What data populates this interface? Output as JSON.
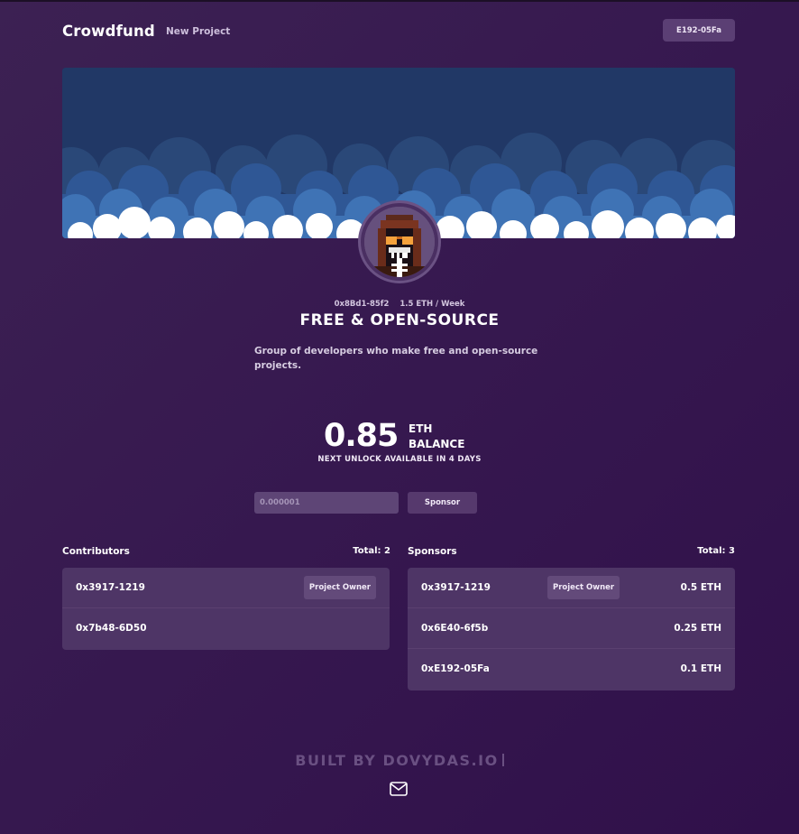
{
  "nav": {
    "brand": "Crowdfund",
    "new_project": "New Project",
    "wallet": "E192-05Fa"
  },
  "project": {
    "owner": "0x8Bd1-85f2",
    "rate": "1.5 ETH / Week",
    "title": "FREE & OPEN-SOURCE",
    "description": "Group of developers who make free and open-source projects."
  },
  "balance": {
    "value": "0.85",
    "unit": "ETH",
    "label": "BALANCE",
    "unlock": "NEXT UNLOCK AVAILABLE IN 4 DAYS"
  },
  "sponsor_form": {
    "placeholder": "0.000001",
    "button": "Sponsor"
  },
  "contributors": {
    "heading": "Contributors",
    "total": "Total: 2",
    "items": [
      {
        "address": "0x3917-1219",
        "badge": "Project Owner"
      },
      {
        "address": "0x7b48-6D50"
      }
    ]
  },
  "sponsors": {
    "heading": "Sponsors",
    "total": "Total: 3",
    "items": [
      {
        "address": "0x3917-1219",
        "badge": "Project Owner",
        "amount": "0.5 ETH"
      },
      {
        "address": "0x6E40-6f5b",
        "amount": "0.25 ETH"
      },
      {
        "address": "0xE192-05Fa",
        "amount": "0.1 ETH"
      }
    ]
  },
  "footer": {
    "text": "BUILT BY DOVYDAS.IO"
  },
  "colors": {
    "background": "#36184f",
    "panel": "#4e3566",
    "button": "#56396d",
    "banner_sky": "#213866",
    "cloud_white": "#ffffff",
    "cloud_blue": "#3f73b5"
  },
  "icons": {
    "mail": "mail-icon",
    "avatar": "pixel-skull-avatar"
  }
}
